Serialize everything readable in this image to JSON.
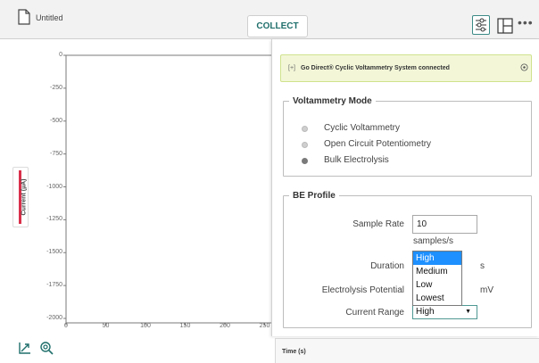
{
  "header": {
    "file_title": "Untitled",
    "collect_label": "COLLECT",
    "more_label": "•••"
  },
  "graph": {
    "y_label": "Current (µA)",
    "y_ticks": [
      "0",
      "-250",
      "-500",
      "-750",
      "-1000",
      "-1250",
      "-1500",
      "-1750",
      "-2000"
    ],
    "x_ticks": [
      "0",
      "50",
      "100",
      "150",
      "200",
      "250"
    ],
    "series_color": "#d9304a",
    "x_axis_label": "Time (s)"
  },
  "panel": {
    "connection_prefix": "[+]",
    "connection_text": "Go Direct® Cyclic Voltammetry System connected",
    "mode": {
      "legend": "Voltammetry Mode",
      "options": [
        {
          "label": "Cyclic Voltammetry",
          "checked": false
        },
        {
          "label": "Open Circuit Potentiometry",
          "checked": false
        },
        {
          "label": "Bulk Electrolysis",
          "checked": true
        }
      ]
    },
    "profile": {
      "legend": "BE Profile",
      "sample_rate_label": "Sample Rate",
      "sample_rate_value": "10",
      "sample_rate_unit": "samples/s",
      "duration_label": "Duration",
      "duration_unit": "s",
      "potential_label": "Electrolysis Potential",
      "potential_unit": "mV",
      "current_range_label": "Current Range",
      "current_range_value": "High",
      "current_range_options": [
        "High",
        "Medium",
        "Low",
        "Lowest"
      ]
    }
  },
  "colors": {
    "accent": "#1f6f6b",
    "banner_bg": "#f3f7d8",
    "dropdown_highlight": "#1e90ff"
  }
}
